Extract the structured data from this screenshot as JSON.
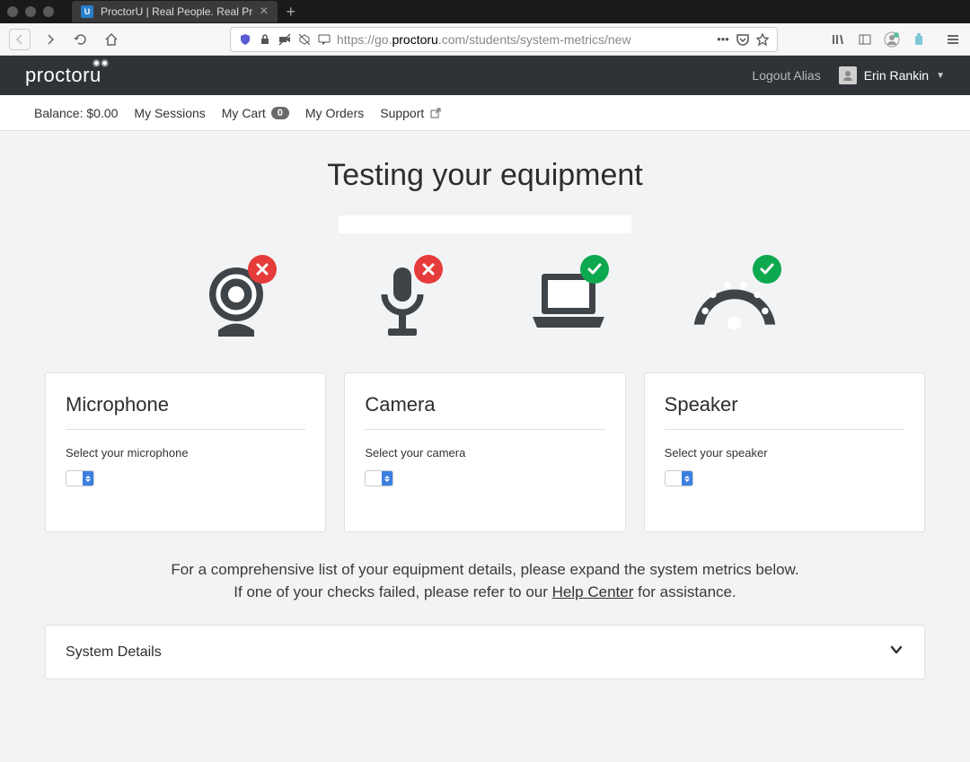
{
  "browser": {
    "tab_title": "ProctorU | Real People. Real Pr",
    "url_prefix": "https://go.",
    "url_domain": "proctoru",
    "url_suffix": ".com/students/system-metrics/new"
  },
  "header": {
    "logo_text": "proctor",
    "logo_u": "u",
    "logout": "Logout Alias",
    "user_name": "Erin Rankin"
  },
  "nav": {
    "balance": "Balance: $0.00",
    "sessions": "My Sessions",
    "cart": "My Cart",
    "cart_count": "0",
    "orders": "My Orders",
    "support": "Support"
  },
  "main": {
    "title": "Testing your equipment",
    "equipment": [
      {
        "name": "camera",
        "status": "fail"
      },
      {
        "name": "microphone",
        "status": "fail"
      },
      {
        "name": "computer",
        "status": "pass"
      },
      {
        "name": "internet",
        "status": "pass"
      }
    ],
    "cards": {
      "microphone": {
        "title": "Microphone",
        "label": "Select your microphone"
      },
      "camera": {
        "title": "Camera",
        "label": "Select your camera"
      },
      "speaker": {
        "title": "Speaker",
        "label": "Select your speaker"
      }
    },
    "help_line1": "For a comprehensive list of your equipment details, please expand the system metrics below.",
    "help_line2_prefix": "If one of your checks failed, please refer to our ",
    "help_link": "Help Center",
    "help_line2_suffix": " for assistance.",
    "accordion_title": "System Details"
  }
}
